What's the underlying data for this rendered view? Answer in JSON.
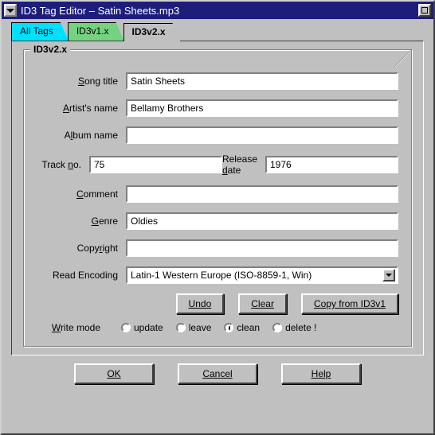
{
  "window": {
    "title": "ID3 Tag Editor – Satin Sheets.mp3"
  },
  "tabs": {
    "all": "All Tags",
    "v1": "ID3v1.x",
    "v2": "ID3v2.x"
  },
  "group": {
    "title": "ID3v2.x"
  },
  "labels": {
    "song": "Song title",
    "artist": "Artist's name",
    "album": "Album name",
    "track": "Track no.",
    "release": "Release date",
    "comment": "Comment",
    "genre": "Genre",
    "copyright": "Copyright",
    "encoding": "Read Encoding",
    "writemode": "Write mode"
  },
  "fields": {
    "song": "Satin Sheets",
    "artist": "Bellamy Brothers",
    "album": "",
    "track": "75",
    "release": "1976",
    "comment": "",
    "genre": "Oldies",
    "copyright": "",
    "encoding": "Latin-1 Western Europe (ISO-8859-1, Win)"
  },
  "buttons": {
    "undo": "Undo",
    "clear": "Clear",
    "copy": "Copy from ID3v1",
    "ok": "OK",
    "cancel": "Cancel",
    "help": "Help"
  },
  "writemode": {
    "update": "update",
    "leave": "leave",
    "clean": "clean",
    "delete": "delete !",
    "selected": "clean"
  }
}
